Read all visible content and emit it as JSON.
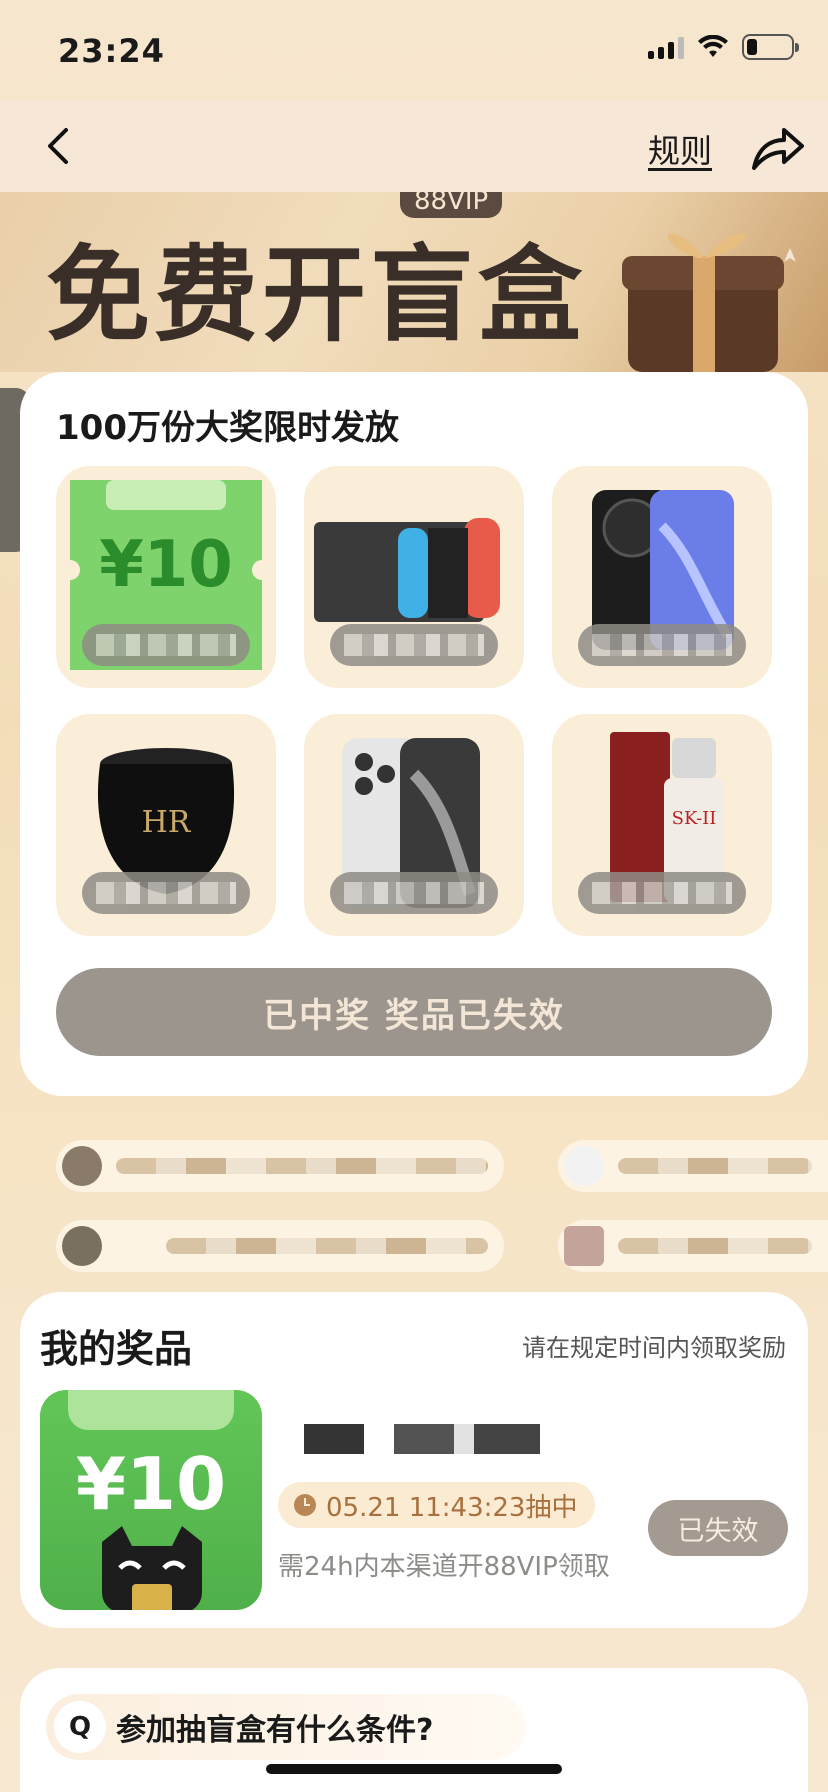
{
  "status_bar": {
    "time": "23:24"
  },
  "nav": {
    "rules_label": "规则"
  },
  "hero": {
    "title": "免费开盲盒",
    "vip_tag": "88VIP"
  },
  "prize_pool": {
    "title": "100万份大奖限时发放",
    "items": [
      {
        "name": "coupon",
        "amount": "¥10"
      },
      {
        "name": "game-console"
      },
      {
        "name": "phone-huawei"
      },
      {
        "name": "face-cream"
      },
      {
        "name": "iphone"
      },
      {
        "name": "skincare-bottle"
      }
    ],
    "status_button": "已中奖 奖品已失效"
  },
  "my_prize": {
    "title": "我的奖品",
    "hint": "请在规定时间内领取奖励",
    "amount": "¥10",
    "draw_time": "05.21 11:43:23抽中",
    "note": "需24h内本渠道开88VIP领取",
    "expired_label": "已失效"
  },
  "faq": {
    "q_badge": "Q",
    "question": "参加抽盲盒有什么条件?"
  },
  "colors": {
    "accent_green": "#4fb04a",
    "status_gray": "#9b958d",
    "brand_brown": "#3a2f28"
  }
}
